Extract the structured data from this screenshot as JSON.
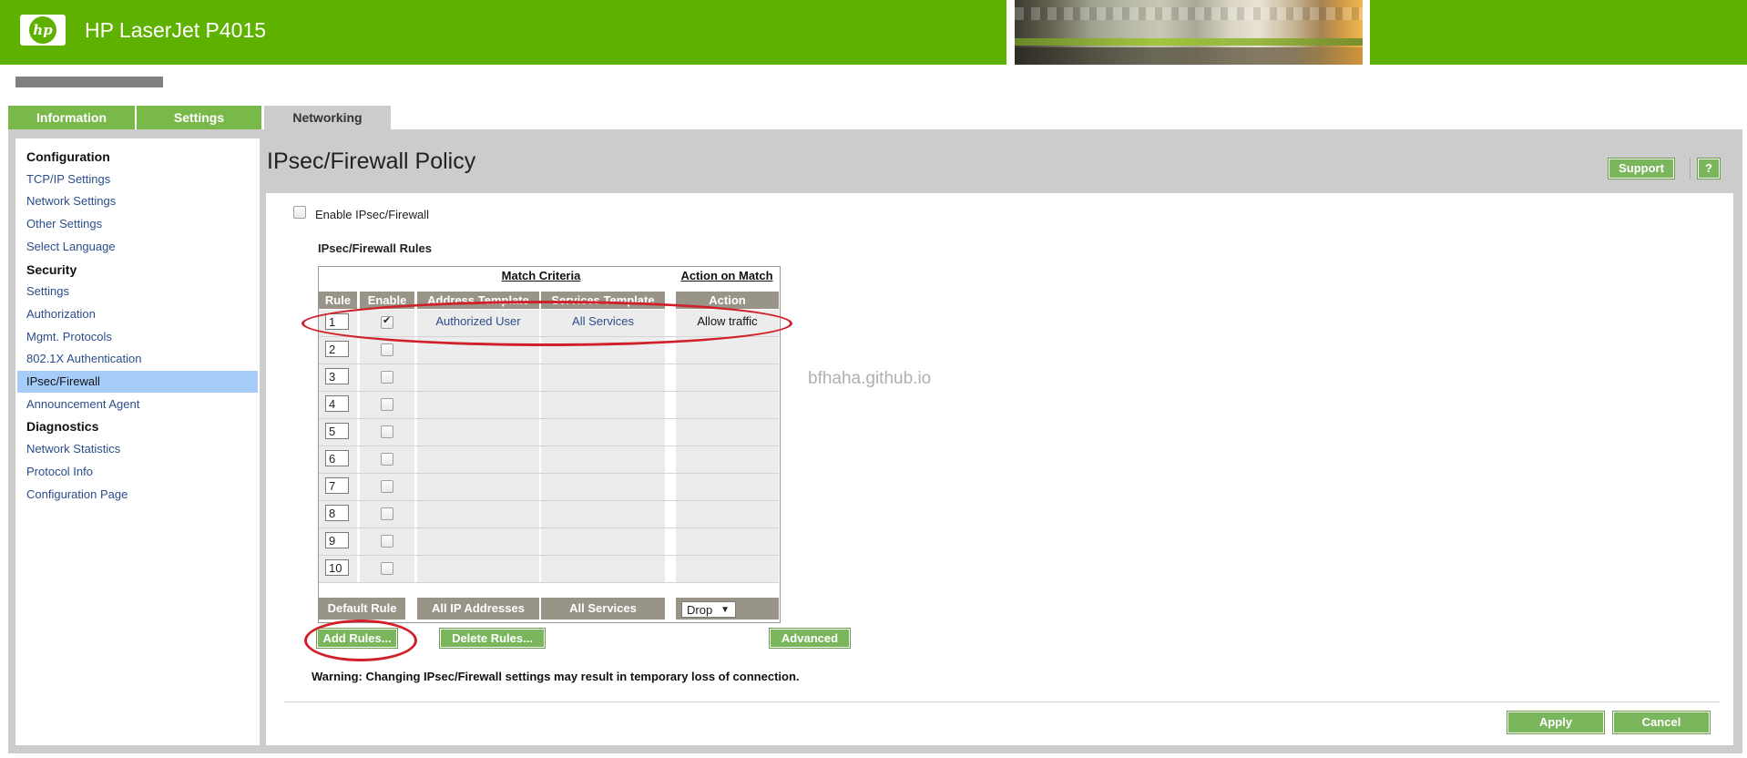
{
  "header": {
    "logo_text": "hp",
    "device_title": "HP LaserJet P4015"
  },
  "tabs": [
    {
      "label": "Information"
    },
    {
      "label": "Settings"
    },
    {
      "label": "Networking"
    }
  ],
  "sidebar": {
    "items": [
      {
        "label": "Configuration",
        "kind": "heading"
      },
      {
        "label": "TCP/IP Settings",
        "kind": "link"
      },
      {
        "label": "Network Settings",
        "kind": "link"
      },
      {
        "label": "Other Settings",
        "kind": "link"
      },
      {
        "label": "Select Language",
        "kind": "link"
      },
      {
        "label": "Security",
        "kind": "heading"
      },
      {
        "label": "Settings",
        "kind": "link"
      },
      {
        "label": "Authorization",
        "kind": "link"
      },
      {
        "label": "Mgmt. Protocols",
        "kind": "link"
      },
      {
        "label": "802.1X Authentication",
        "kind": "link"
      },
      {
        "label": "IPsec/Firewall",
        "kind": "link",
        "selected": true
      },
      {
        "label": "Announcement Agent",
        "kind": "link"
      },
      {
        "label": "Diagnostics",
        "kind": "heading"
      },
      {
        "label": "Network Statistics",
        "kind": "link"
      },
      {
        "label": "Protocol Info",
        "kind": "link"
      },
      {
        "label": "Configuration Page",
        "kind": "link"
      }
    ]
  },
  "page": {
    "title": "IPsec/Firewall Policy",
    "support_label": "Support",
    "help_label": "?",
    "enable_label": "Enable IPsec/Firewall",
    "enable_checked": false,
    "rules_title": "IPsec/Firewall Rules"
  },
  "rules_table": {
    "group_match": "Match Criteria",
    "group_action": "Action on Match",
    "headers": {
      "rule": "Rule",
      "enable": "Enable",
      "address": "Address Template",
      "services": "Services Template",
      "action": "Action"
    },
    "rows": [
      {
        "rule": "1",
        "enabled": true,
        "address": "Authorized User",
        "services": "All Services",
        "action": "Allow traffic"
      },
      {
        "rule": "2",
        "enabled": false,
        "address": "",
        "services": "",
        "action": ""
      },
      {
        "rule": "3",
        "enabled": false,
        "address": "",
        "services": "",
        "action": ""
      },
      {
        "rule": "4",
        "enabled": false,
        "address": "",
        "services": "",
        "action": ""
      },
      {
        "rule": "5",
        "enabled": false,
        "address": "",
        "services": "",
        "action": ""
      },
      {
        "rule": "6",
        "enabled": false,
        "address": "",
        "services": "",
        "action": ""
      },
      {
        "rule": "7",
        "enabled": false,
        "address": "",
        "services": "",
        "action": ""
      },
      {
        "rule": "8",
        "enabled": false,
        "address": "",
        "services": "",
        "action": ""
      },
      {
        "rule": "9",
        "enabled": false,
        "address": "",
        "services": "",
        "action": ""
      },
      {
        "rule": "10",
        "enabled": false,
        "address": "",
        "services": "",
        "action": ""
      }
    ],
    "default_rule": {
      "label": "Default Rule",
      "address": "All IP Addresses",
      "services": "All Services",
      "action": "Drop"
    }
  },
  "buttons": {
    "add_rules": "Add Rules...",
    "delete_rules": "Delete Rules...",
    "advanced": "Advanced",
    "apply": "Apply",
    "cancel": "Cancel"
  },
  "warning": "Warning: Changing IPsec/Firewall settings may result in temporary loss of connection.",
  "watermark": "bfhaha.github.io",
  "colors": {
    "brand_green": "#5fb100",
    "button_green": "#7ab65b",
    "selected_nav": "#a6cdfa",
    "table_header": "#999488",
    "annotation_red": "#d0202a"
  }
}
